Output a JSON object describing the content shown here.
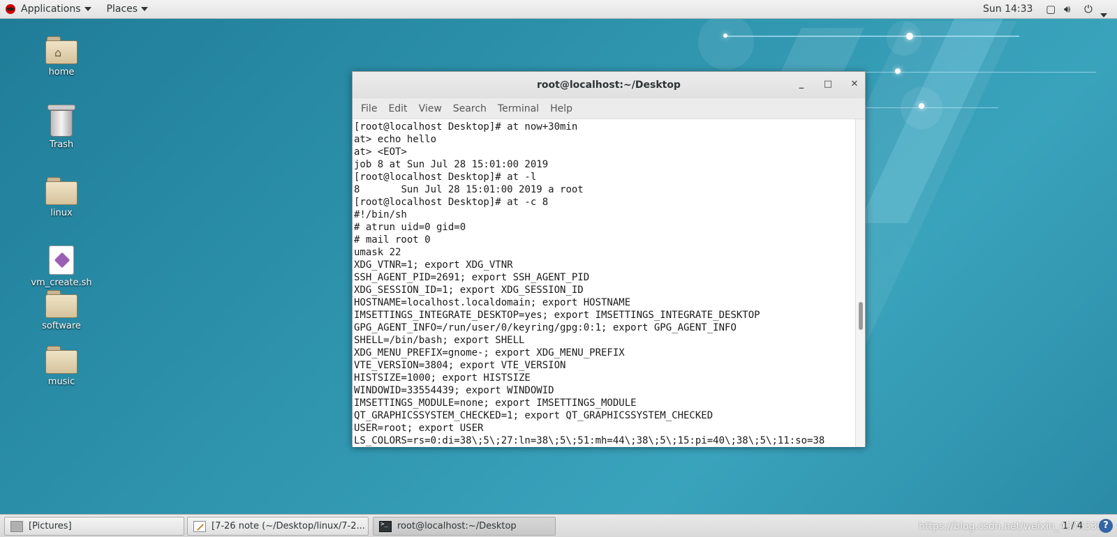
{
  "topbar": {
    "applications": "Applications",
    "places": "Places",
    "clock": "Sun 14:33"
  },
  "desktop": {
    "icons": [
      {
        "label": "home"
      },
      {
        "label": "Trash"
      },
      {
        "label": "linux"
      },
      {
        "label": "vm_create.sh"
      },
      {
        "label": "software"
      },
      {
        "label": "music"
      }
    ]
  },
  "window": {
    "title": "root@localhost:~/Desktop",
    "menu": [
      "File",
      "Edit",
      "View",
      "Search",
      "Terminal",
      "Help"
    ],
    "lines": [
      "[root@localhost Desktop]# at now+30min",
      "at> echo hello",
      "at> <EOT>",
      "job 8 at Sun Jul 28 15:01:00 2019",
      "[root@localhost Desktop]# at -l",
      "8\tSun Jul 28 15:01:00 2019 a root",
      "[root@localhost Desktop]# at -c 8",
      "#!/bin/sh",
      "# atrun uid=0 gid=0",
      "# mail root 0",
      "umask 22",
      "XDG_VTNR=1; export XDG_VTNR",
      "SSH_AGENT_PID=2691; export SSH_AGENT_PID",
      "XDG_SESSION_ID=1; export XDG_SESSION_ID",
      "HOSTNAME=localhost.localdomain; export HOSTNAME",
      "IMSETTINGS_INTEGRATE_DESKTOP=yes; export IMSETTINGS_INTEGRATE_DESKTOP",
      "GPG_AGENT_INFO=/run/user/0/keyring/gpg:0:1; export GPG_AGENT_INFO",
      "SHELL=/bin/bash; export SHELL",
      "XDG_MENU_PREFIX=gnome-; export XDG_MENU_PREFIX",
      "VTE_VERSION=3804; export VTE_VERSION",
      "HISTSIZE=1000; export HISTSIZE",
      "WINDOWID=33554439; export WINDOWID",
      "IMSETTINGS_MODULE=none; export IMSETTINGS_MODULE",
      "QT_GRAPHICSSYSTEM_CHECKED=1; export QT_GRAPHICSSYSTEM_CHECKED",
      "USER=root; export USER",
      "LS_COLORS=rs=0:di=38\\;5\\;27:ln=38\\;5\\;51:mh=44\\;38\\;5\\;15:pi=40\\;38\\;5\\;11:so=38"
    ]
  },
  "taskbar": {
    "tasks": [
      {
        "label": "[Pictures]"
      },
      {
        "label": "[7-26 note (~/Desktop/linux/7-2..."
      },
      {
        "label": "root@localhost:~/Desktop"
      }
    ],
    "watermark": "https://blog.csdn.net/weixin_43763393",
    "pager": "1 / 4"
  }
}
